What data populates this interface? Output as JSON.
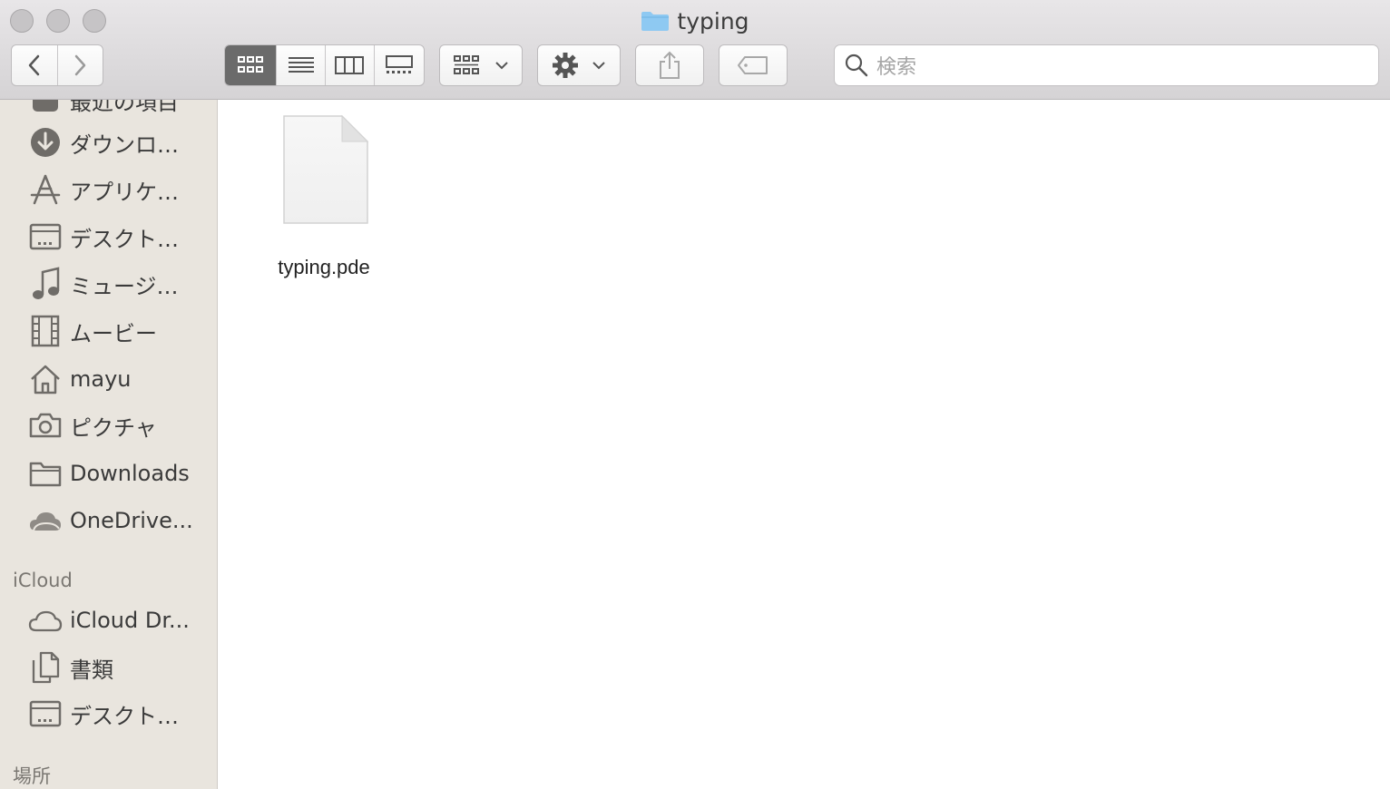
{
  "window": {
    "title": "typing"
  },
  "toolbar": {
    "search_placeholder": "検索",
    "view_modes": [
      "icon",
      "list",
      "column",
      "gallery"
    ],
    "active_view": "icon"
  },
  "sidebar": {
    "partial_top_label": "最近の項目",
    "favorites": [
      {
        "label": "ダウンロ…",
        "icon": "download-icon"
      },
      {
        "label": "アプリケ…",
        "icon": "applications-icon"
      },
      {
        "label": "デスクト…",
        "icon": "desktop-icon"
      },
      {
        "label": "ミュージ…",
        "icon": "music-icon"
      },
      {
        "label": "ムービー",
        "icon": "movies-icon"
      },
      {
        "label": "mayu",
        "icon": "home-icon"
      },
      {
        "label": "ピクチャ",
        "icon": "pictures-icon"
      },
      {
        "label": "Downloads",
        "icon": "folder-icon"
      },
      {
        "label": "OneDrive...",
        "icon": "cloud-icon"
      }
    ],
    "icloud_header": "iCloud",
    "icloud": [
      {
        "label": "iCloud Dr...",
        "icon": "icloud-icon"
      },
      {
        "label": "書類",
        "icon": "documents-icon"
      },
      {
        "label": "デスクト…",
        "icon": "desktop-icon"
      }
    ],
    "locations_header": "場所"
  },
  "main": {
    "files": [
      {
        "name": "typing.pde",
        "icon": "document-icon"
      }
    ]
  },
  "colors": {
    "title_folder": "#8ec9f2",
    "sidebar_bg": "#e9e5de",
    "active_segment": "#6b6b6b"
  }
}
